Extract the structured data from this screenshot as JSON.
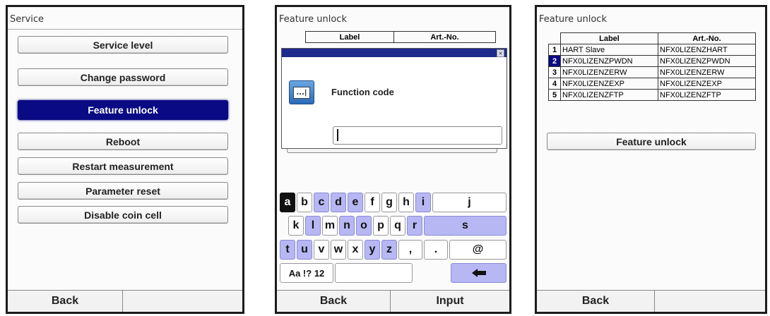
{
  "screen1": {
    "title": "Service",
    "menu": [
      "Service level",
      "Change password",
      "Feature unlock",
      "Reboot",
      "Restart measurement",
      "Parameter reset",
      "Disable coin cell"
    ],
    "selected_index": 2,
    "footer_left": "Back",
    "footer_right": ""
  },
  "screen2": {
    "title": "Feature unlock",
    "table_headers": [
      "Label",
      "Art.-No."
    ],
    "dialog": {
      "close_icon": "×",
      "icon_text": "...|",
      "label": "Function code",
      "input_value": ""
    },
    "keyboard": {
      "row1": [
        "a",
        "b",
        "c",
        "d",
        "e",
        "f",
        "g",
        "h",
        "i",
        "j"
      ],
      "row2": [
        "k",
        "l",
        "m",
        "n",
        "o",
        "p",
        "q",
        "r",
        "s"
      ],
      "row3": [
        "t",
        "u",
        "v",
        "w",
        "x",
        "y",
        "z",
        ",",
        ".",
        "@"
      ],
      "mode_key": "Aa !? 12",
      "backspace_icon": "left-arrow-icon"
    },
    "footer_left": "Back",
    "footer_right": "Input"
  },
  "screen3": {
    "title": "Feature unlock",
    "table_headers": [
      "Label",
      "Art.-No."
    ],
    "rows": [
      {
        "idx": "1",
        "label": "HART Slave",
        "art": "NFX0LIZENZHART"
      },
      {
        "idx": "2",
        "label": "NFX0LIZENZPWDN",
        "art": "NFX0LIZENZPWDN"
      },
      {
        "idx": "3",
        "label": "NFX0LIZENZERW",
        "art": "NFX0LIZENZERW"
      },
      {
        "idx": "4",
        "label": "NFX0LIZENZEXP",
        "art": "NFX0LIZENZEXP"
      },
      {
        "idx": "5",
        "label": "NFX0LIZENZFTP",
        "art": "NFX0LIZENZFTP"
      }
    ],
    "selected_index": 1,
    "button": "Feature unlock",
    "footer_left": "Back",
    "footer_right": ""
  }
}
